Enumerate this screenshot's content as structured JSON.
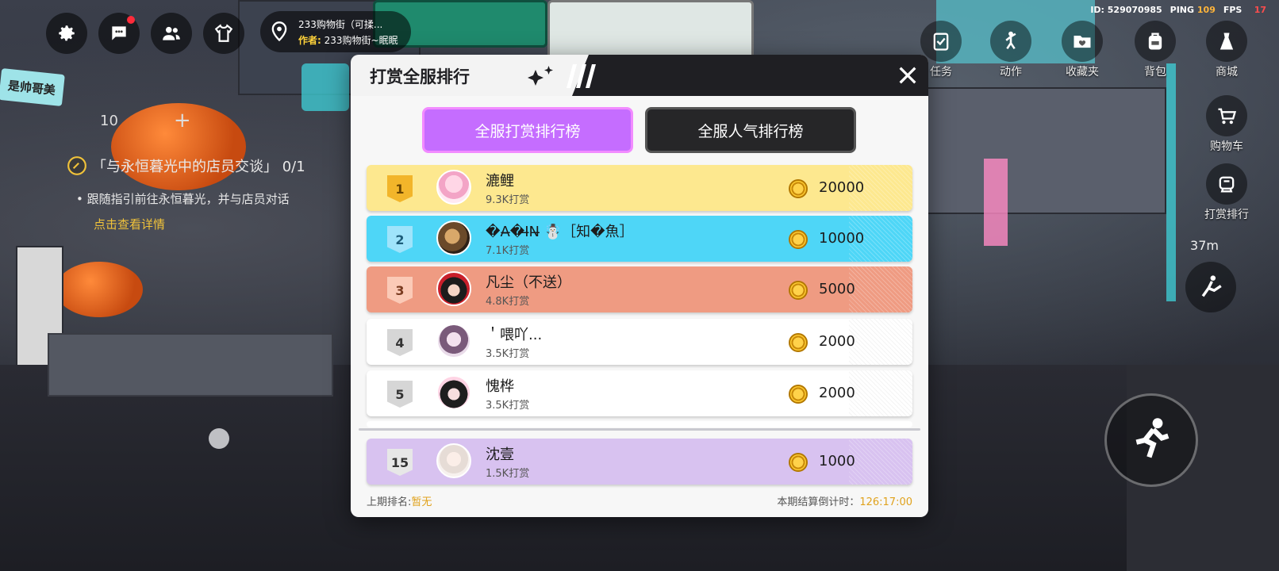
{
  "hud": {
    "map_name": "233购物街（可揉...",
    "author_label": "作者:",
    "author_name": "233购物街~眠眠",
    "id_label": "ID: 529070985",
    "ping_label": "PING",
    "ping_value": "109",
    "fps_label": "FPS",
    "fps_value": "17",
    "top_buttons": [
      {
        "label": "任务"
      },
      {
        "label": "动作"
      },
      {
        "label": "收藏夹"
      },
      {
        "label": "背包"
      },
      {
        "label": "商城"
      }
    ],
    "side_buttons": [
      {
        "label": "购物车"
      },
      {
        "label": "打赏排行"
      }
    ],
    "distance": "37m"
  },
  "quest": {
    "count": "10",
    "plus": "+",
    "title": "「与永恒暮光中的店员交谈」 0/1",
    "desc": "• 跟随指引前往永恒暮光，并与店员对话",
    "detail": "点击查看详情",
    "sign_text": "是帅哥美"
  },
  "modal": {
    "title": "打赏全服排行",
    "tabs": [
      {
        "label": "全服打赏排行榜",
        "active": true
      },
      {
        "label": "全服人气排行榜",
        "active": false
      }
    ],
    "rows": [
      {
        "rank": "1",
        "name": "漉鲤",
        "sub": "9.3K打赏",
        "amount": "20000",
        "style": "gold"
      },
      {
        "rank": "2",
        "name": "�A̶�I̶N̶ ☃️［知�魚］",
        "sub": "7.1K打赏",
        "amount": "10000",
        "style": "blue"
      },
      {
        "rank": "3",
        "name": "凡尘（不送）",
        "sub": "4.8K打赏",
        "amount": "5000",
        "style": "bronze"
      },
      {
        "rank": "4",
        "name": "＇喂吖...",
        "sub": "3.5K打赏",
        "amount": "2000",
        "style": "white"
      },
      {
        "rank": "5",
        "name": "愧桦",
        "sub": "3.5K打赏",
        "amount": "2000",
        "style": "white"
      }
    ],
    "self_row": {
      "rank": "15",
      "name": "沈壹",
      "sub": "1.5K打赏",
      "amount": "1000"
    },
    "footer_left_label": "上期排名:",
    "footer_left_value": "暂无",
    "footer_right_label": "本期结算倒计时：",
    "footer_right_value": "126:17:00"
  },
  "colors": {
    "gold": "#fde88f",
    "blue": "#4ed6f7",
    "bronze": "#ef9b82",
    "self": "#d8c2f0",
    "tab_active": "#c56dff",
    "accent_yellow": "#e0a21d"
  }
}
